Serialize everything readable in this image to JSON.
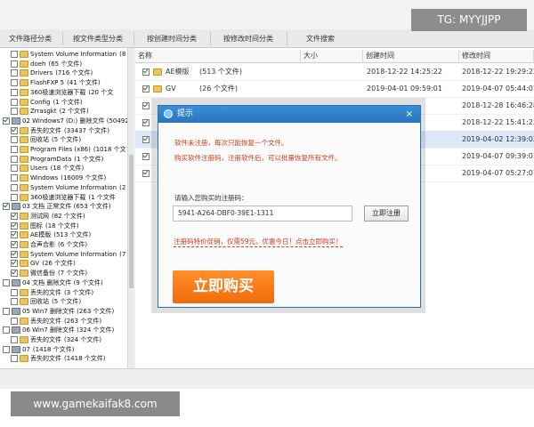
{
  "watermarks": {
    "top": "TG: MYYJJPP",
    "bottom": "www.gamekaifak8.com"
  },
  "toolbar": {
    "tabs": [
      "文件路径分类",
      "按文件类型分类",
      "按创建时间分类",
      "按修改时间分类",
      "文件搜索"
    ]
  },
  "tree": {
    "items": [
      {
        "label": "System Volume Information",
        "count": "(8 -",
        "type": "folder",
        "checked": false
      },
      {
        "label": "doeh",
        "count": "(65 个文件)",
        "type": "folder",
        "checked": false
      },
      {
        "label": "Drivers",
        "count": "(716 个文件)",
        "type": "folder",
        "checked": false
      },
      {
        "label": "FlashFXP 5",
        "count": "(41 个文件)",
        "type": "folder",
        "checked": false
      },
      {
        "label": "360极速浏览器下载",
        "count": "(20 个文",
        "type": "folder",
        "checked": false
      },
      {
        "label": "Config",
        "count": "(1 个文件)",
        "type": "folder",
        "checked": false
      },
      {
        "label": "Zrrasgkt",
        "count": "(2 个文件)",
        "type": "folder",
        "checked": false
      },
      {
        "label": "02 Windows7 (D:) 删除文件 (50492 -",
        "count": "",
        "type": "drive",
        "checked": true
      },
      {
        "label": "丢失的文件",
        "count": "(33437 个文件)",
        "type": "folder",
        "checked": true
      },
      {
        "label": "回收站",
        "count": "(5 个文件)",
        "type": "folder",
        "checked": false
      },
      {
        "label": "Program Files (x86)",
        "count": "(1018 个文",
        "type": "folder",
        "checked": false
      },
      {
        "label": "ProgramData",
        "count": "(1 个文件)",
        "type": "folder",
        "checked": false
      },
      {
        "label": "Users",
        "count": "(18 个文件)",
        "type": "folder",
        "checked": false
      },
      {
        "label": "Windows",
        "count": "(16009 个文件)",
        "type": "folder",
        "checked": false
      },
      {
        "label": "System Volume Information",
        "count": "(2 -",
        "type": "folder",
        "checked": false
      },
      {
        "label": "360极速浏览器下载",
        "count": "(1 个文件",
        "type": "folder",
        "checked": false
      },
      {
        "label": "03 文档 正常文件 (653 个文件)",
        "count": "",
        "type": "drive",
        "checked": true
      },
      {
        "label": "测试网",
        "count": "(82 个文件)",
        "type": "folder",
        "checked": true
      },
      {
        "label": "图标",
        "count": "(18 个文件)",
        "type": "folder",
        "checked": true
      },
      {
        "label": "AE模版",
        "count": "(513 个文件)",
        "type": "folder",
        "checked": true
      },
      {
        "label": "合声合影",
        "count": "(6 个文件)",
        "type": "folder",
        "checked": true
      },
      {
        "label": "System Volume Information",
        "count": "(7 -",
        "type": "folder",
        "checked": true
      },
      {
        "label": "GV",
        "count": "(26 个文件)",
        "type": "folder",
        "checked": true
      },
      {
        "label": "微信备份",
        "count": "(7 个文件)",
        "type": "folder",
        "checked": true
      },
      {
        "label": "04 文档 删除文件 (9 个文件)",
        "count": "",
        "type": "drive",
        "checked": false
      },
      {
        "label": "丢失的文件",
        "count": "(3 个文件)",
        "type": "folder",
        "checked": false
      },
      {
        "label": "回收站",
        "count": "(5 个文件)",
        "type": "folder",
        "checked": false
      },
      {
        "label": "05 Win7 删除文件 (263 个文件)",
        "count": "",
        "type": "drive",
        "checked": false
      },
      {
        "label": "丢失的文件",
        "count": "(263 个文件)",
        "type": "folder",
        "checked": false
      },
      {
        "label": "06 Win7 删除文件 (324 个文件)",
        "count": "",
        "type": "drive",
        "checked": false
      },
      {
        "label": "丢失的文件",
        "count": "(324 个文件)",
        "type": "folder",
        "checked": false
      },
      {
        "label": "07",
        "count": "(1418 个文件)",
        "type": "drive",
        "checked": false
      },
      {
        "label": "丢失的文件",
        "count": "(1418 个文件)",
        "type": "folder",
        "checked": false
      }
    ]
  },
  "list": {
    "headers": {
      "name": "名称",
      "size": "大小",
      "created": "创建时间",
      "modified": "修改时间"
    },
    "rows": [
      {
        "name": "AE模版",
        "count": "(513 个文件)",
        "size": "",
        "created": "2018-12-22  14:25:22",
        "modified": "2018-12-22  19:29:22",
        "selected": false
      },
      {
        "name": "GV",
        "count": "(26 个文件)",
        "size": "",
        "created": "2019-04-01  09:59:01",
        "modified": "2019-04-07  05:44:07",
        "selected": false
      },
      {
        "name": "",
        "count": "",
        "size": "",
        "created": "",
        "modified": "2018-12-28  16:46:28",
        "selected": false
      },
      {
        "name": "",
        "count": "",
        "size": "",
        "created": "",
        "modified": "2018-12-22  15:41:22",
        "selected": false
      },
      {
        "name": "",
        "count": "",
        "size": "",
        "created": "21",
        "modified": "2019-04-02  12:39:02",
        "selected": true
      },
      {
        "name": "",
        "count": "",
        "size": "",
        "created": "",
        "modified": "2019-04-07  09:39:07",
        "selected": false
      },
      {
        "name": "",
        "count": "",
        "size": "",
        "created": "",
        "modified": "2019-04-07  05:27:07",
        "selected": false
      }
    ]
  },
  "dialog": {
    "title": "提示",
    "close": "×",
    "warning_line1": "软件未注册，每次只能恢复一个文件。",
    "warning_line2": "购买软件注册码，注册软件后，可以批量恢复所有文件。",
    "prompt": "请输入您购买的注册码：",
    "code_value": "5941-A264-DBF0-39E1-1311",
    "register_button": "立即注册",
    "promo_link": "注册码特价促销，仅需59元，优惠今日！点击立即购买！",
    "buy_button": "立即购买"
  },
  "colors": {
    "accent_blue": "#2a74bb",
    "warn_red": "#d23a1c",
    "buy_orange": "#f06c0c",
    "selection": "#dce8f7"
  }
}
